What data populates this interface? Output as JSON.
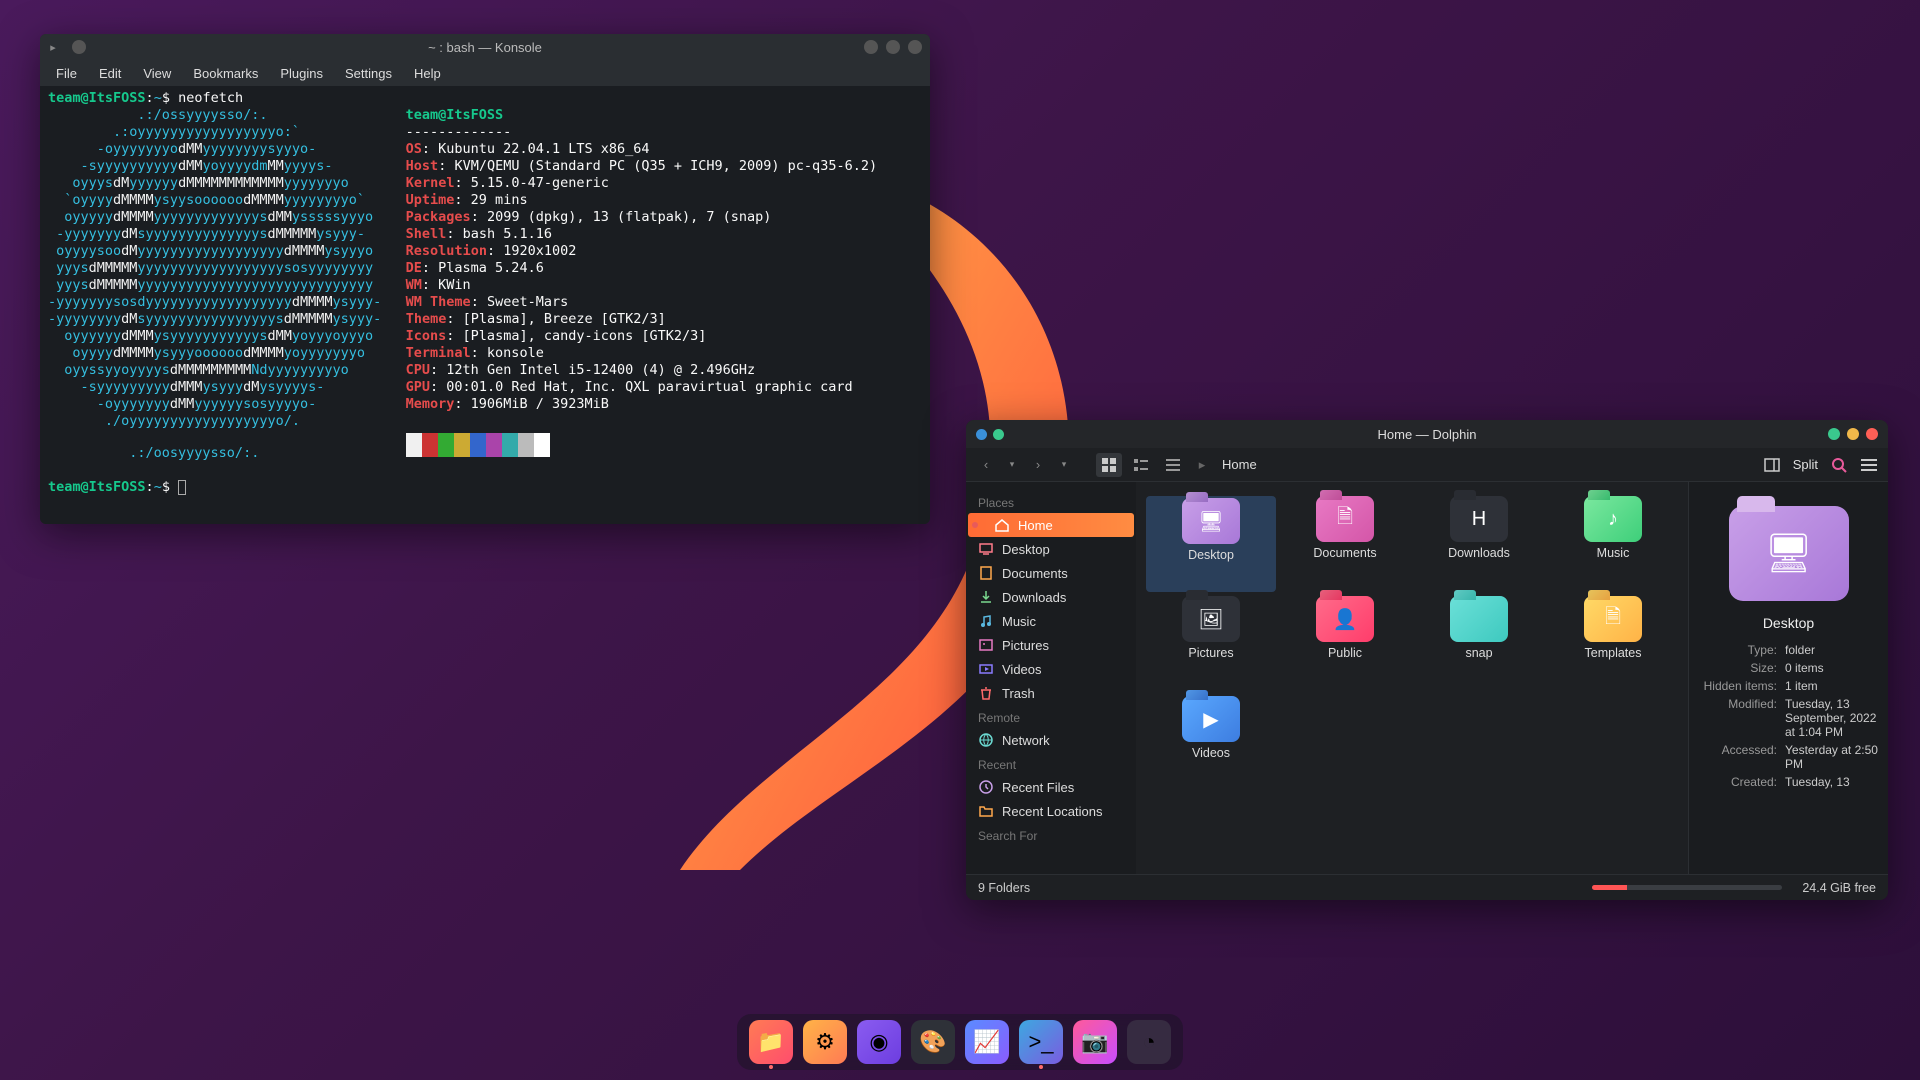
{
  "konsole": {
    "title": "~ : bash — Konsole",
    "menu": [
      "File",
      "Edit",
      "View",
      "Bookmarks",
      "Plugins",
      "Settings",
      "Help"
    ],
    "prompt_user": "team@ItsFOSS",
    "prompt_sep": ":",
    "prompt_path": "~",
    "prompt_sym": "$",
    "cmd": "neofetch",
    "ascii": [
      "           .:/ossyyyysso/:.",
      "        .:oyyyyyyyyyyyyyyyyyo:`",
      "      -oyyyyyyyodMMyyyyyyyysyyyo-",
      "    -syyyyyyyyyydMMyoyyyydmMMyyyys-",
      "   oyyysdMyyyyyydMMMMMMMMMMMMyyyyyyyo",
      "  `oyyyydMMMMysyysoooooodMMMMyyyyyyyyo`",
      "  oyyyyydMMMMyyyyyyyyyyyyysdMMysssssyyyo",
      " -yyyyyyydMsyyyyyyyyyyyyyysdMMMMMysyyy-",
      " oyyyysoodMyyyyyyyyyyyyyyyyyydMMMMysyyyo",
      " yyysdMMMMMyyyyyyyyyyyyyyyyyysosyyyyyyyy",
      " yyysdMMMMMyyyyyyyyyyyyyyyyyyyyyyyyyyyyy",
      "-yyyyyyysosdyyyyyyyyyyyyyyyyyydMMMMysyyy-",
      "-yyyyyyyydMsyyyyyyyyyyyyyyyysdMMMMMysyyy-",
      "  oyyyyyydMMMysyyyyyyyyyyysdMMyoyyyoyyyo",
      "   oyyyydMMMMysyyyoooooodMMMMyoyyyyyyyo",
      "  oyyssyyoyyyysdMMMMMMMMMNdyyyyyyyyyo",
      "    -syyyyyyyyydMMMysyyydMysyyyys-",
      "      -oyyyyyyydMMyyyyyysosyyyyo-",
      "       ./oyyyyyyyyyyyyyyyyyyo/.",
      "          .:/oosyyyysso/:.  "
    ],
    "info_user": "team@ItsFOSS",
    "dashes": "-------------",
    "lines": [
      {
        "k": "OS",
        "v": "Kubuntu 22.04.1 LTS x86_64"
      },
      {
        "k": "Host",
        "v": "KVM/QEMU (Standard PC (Q35 + ICH9, 2009) pc-q35-6.2)"
      },
      {
        "k": "Kernel",
        "v": "5.15.0-47-generic"
      },
      {
        "k": "Uptime",
        "v": "29 mins"
      },
      {
        "k": "Packages",
        "v": "2099 (dpkg), 13 (flatpak), 7 (snap)"
      },
      {
        "k": "Shell",
        "v": "bash 5.1.16"
      },
      {
        "k": "Resolution",
        "v": "1920x1002"
      },
      {
        "k": "DE",
        "v": "Plasma 5.24.6"
      },
      {
        "k": "WM",
        "v": "KWin"
      },
      {
        "k": "WM Theme",
        "v": "Sweet-Mars"
      },
      {
        "k": "Theme",
        "v": "[Plasma], Breeze [GTK2/3]"
      },
      {
        "k": "Icons",
        "v": "[Plasma], candy-icons [GTK2/3]"
      },
      {
        "k": "Terminal",
        "v": "konsole"
      },
      {
        "k": "CPU",
        "v": "12th Gen Intel i5-12400 (4) @ 2.496GHz"
      },
      {
        "k": "GPU",
        "v": "00:01.0 Red Hat, Inc. QXL paravirtual graphic card"
      },
      {
        "k": "Memory",
        "v": "1906MiB / 3923MiB"
      }
    ],
    "swatches": [
      "#f0f0f0",
      "#cc3333",
      "#33aa33",
      "#ccaa33",
      "#3366cc",
      "#aa44aa",
      "#33aaaa",
      "#bbbbbb",
      "#ffffff"
    ]
  },
  "dolphin": {
    "title": "Home — Dolphin",
    "crumb": "Home",
    "split_label": "Split",
    "sidebar": {
      "places_head": "Places",
      "places": [
        {
          "label": "Home",
          "icon": "home",
          "active": true,
          "dot": true
        },
        {
          "label": "Desktop",
          "icon": "desktop"
        },
        {
          "label": "Documents",
          "icon": "doc"
        },
        {
          "label": "Downloads",
          "icon": "down"
        },
        {
          "label": "Music",
          "icon": "music"
        },
        {
          "label": "Pictures",
          "icon": "pic"
        },
        {
          "label": "Videos",
          "icon": "video"
        },
        {
          "label": "Trash",
          "icon": "trash"
        }
      ],
      "remote_head": "Remote",
      "remote": [
        {
          "label": "Network",
          "icon": "net"
        }
      ],
      "recent_head": "Recent",
      "recent": [
        {
          "label": "Recent Files",
          "icon": "clock"
        },
        {
          "label": "Recent Locations",
          "icon": "folder"
        }
      ],
      "search_head": "Search For"
    },
    "folders": [
      {
        "label": "Desktop",
        "color": "linear-gradient(135deg,#c89fe8,#a878d8)",
        "glyph": "🖥",
        "selected": true
      },
      {
        "label": "Documents",
        "color": "linear-gradient(135deg,#e879c4,#d456a8)",
        "glyph": "🗎"
      },
      {
        "label": "Downloads",
        "color": "#2e3138",
        "glyph": "H",
        "thumb": true
      },
      {
        "label": "Music",
        "color": "linear-gradient(135deg,#7be89f,#3ecf7a)",
        "glyph": "♪"
      },
      {
        "label": "Pictures",
        "color": "#2e3138",
        "glyph": "🖼",
        "thumb": true
      },
      {
        "label": "Public",
        "color": "linear-gradient(135deg,#ff6b8a,#ff3d6b)",
        "glyph": "👤"
      },
      {
        "label": "snap",
        "color": "linear-gradient(135deg,#6be0d8,#3ec9bf)",
        "glyph": ""
      },
      {
        "label": "Templates",
        "color": "linear-gradient(135deg,#ffd966,#ffb347)",
        "glyph": "🗎"
      },
      {
        "label": "Videos",
        "color": "linear-gradient(135deg,#5aa8ff,#3d7de0)",
        "glyph": "▶"
      }
    ],
    "status": {
      "count": "9 Folders",
      "free": "24.4 GiB free",
      "pct": 18
    },
    "info": {
      "name": "Desktop",
      "rows": [
        {
          "k": "Type:",
          "v": "folder"
        },
        {
          "k": "Size:",
          "v": "0 items"
        },
        {
          "k": "Hidden items:",
          "v": "1 item"
        },
        {
          "k": "Modified:",
          "v": "Tuesday, 13 September, 2022 at 1:04 PM"
        },
        {
          "k": "Accessed:",
          "v": "Yesterday at 2:50 PM"
        },
        {
          "k": "Created:",
          "v": "Tuesday, 13"
        }
      ]
    }
  },
  "dock": [
    {
      "name": "files",
      "glyph": "📁",
      "bg": "linear-gradient(135deg,#ff7b54,#ff4d6d)",
      "running": true
    },
    {
      "name": "settings",
      "glyph": "⚙",
      "bg": "linear-gradient(135deg,#ffb347,#ff7b54)"
    },
    {
      "name": "media",
      "glyph": "◉",
      "bg": "linear-gradient(135deg,#8a5cf0,#6d3de0)"
    },
    {
      "name": "krita",
      "glyph": "🎨",
      "bg": "#2e3138"
    },
    {
      "name": "monitor",
      "glyph": "📈",
      "bg": "linear-gradient(135deg,#5a8cff,#8a5cff)"
    },
    {
      "name": "terminal",
      "glyph": ">_",
      "bg": "linear-gradient(135deg,#3da8e0,#7a5ce0)",
      "running": true
    },
    {
      "name": "camera",
      "glyph": "📷",
      "bg": "linear-gradient(135deg,#ff5a9a,#c84dff)"
    },
    {
      "name": "clock",
      "glyph": "◔",
      "bg": "rgba(80,80,90,0.4)"
    }
  ]
}
